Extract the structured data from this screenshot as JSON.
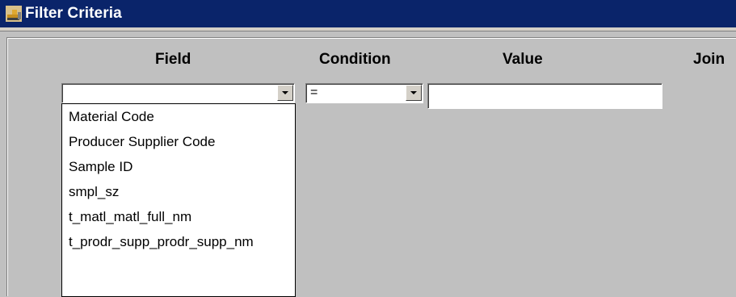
{
  "window": {
    "title": "Filter Criteria",
    "icon": "bulldozer-app-icon"
  },
  "columns": {
    "field": "Field",
    "condition": "Condition",
    "value": "Value",
    "join": "Join"
  },
  "row": {
    "field_value": "",
    "condition_value": "=",
    "value_value": ""
  },
  "field_options": [
    "Material Code",
    "Producer Supplier Code",
    "Sample ID",
    "smpl_sz",
    "t_matl_matl_full_nm",
    "t_prodr_supp_prodr_supp_nm"
  ],
  "colors": {
    "titlebar": "#0a246a",
    "window_bg": "#c0c0c0",
    "input_bg": "#ffffff"
  }
}
